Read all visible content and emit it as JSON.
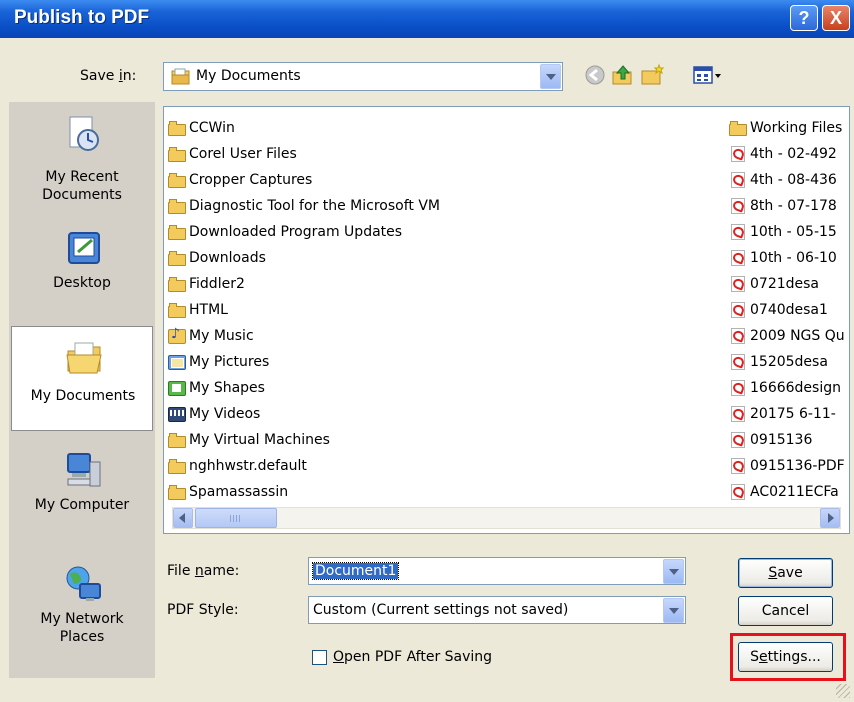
{
  "window": {
    "title": "Publish to PDF"
  },
  "titlebar": {
    "help_glyph": "?",
    "close_glyph": "X"
  },
  "save_in": {
    "label_pre": "Save ",
    "label_u": "i",
    "label_post": "n:",
    "value": "My Documents"
  },
  "toolbar_icons": [
    "back-icon",
    "up-folder-icon",
    "new-folder-icon",
    "views-menu-icon"
  ],
  "places": [
    {
      "name": "recent",
      "label": "My Recent\nDocuments",
      "icon": "recent-documents-icon"
    },
    {
      "name": "desktop",
      "label": "Desktop",
      "icon": "desktop-icon"
    },
    {
      "name": "documents",
      "label": "My Documents",
      "icon": "my-documents-icon",
      "selected": true
    },
    {
      "name": "computer",
      "label": "My Computer",
      "icon": "my-computer-icon"
    },
    {
      "name": "network",
      "label": "My Network\nPlaces",
      "icon": "network-places-icon"
    }
  ],
  "files_col1": [
    {
      "name": "CCWin",
      "type": "folder"
    },
    {
      "name": "Corel User Files",
      "type": "folder"
    },
    {
      "name": "Cropper Captures",
      "type": "folder"
    },
    {
      "name": "Diagnostic Tool for the Microsoft VM",
      "type": "folder"
    },
    {
      "name": "Downloaded Program Updates",
      "type": "folder"
    },
    {
      "name": "Downloads",
      "type": "folder"
    },
    {
      "name": "Fiddler2",
      "type": "folder"
    },
    {
      "name": "HTML",
      "type": "folder"
    },
    {
      "name": "My Music",
      "type": "music"
    },
    {
      "name": "My Pictures",
      "type": "pics"
    },
    {
      "name": "My Shapes",
      "type": "shapes"
    },
    {
      "name": "My Videos",
      "type": "videos"
    },
    {
      "name": "My Virtual Machines",
      "type": "folder"
    },
    {
      "name": "nghhwstr.default",
      "type": "folder"
    },
    {
      "name": "Spamassassin",
      "type": "folder"
    }
  ],
  "files_col2": [
    {
      "name": "Working Files",
      "type": "folder"
    },
    {
      "name": "4th - 02-492",
      "type": "pdf"
    },
    {
      "name": "4th - 08-436",
      "type": "pdf"
    },
    {
      "name": "8th - 07-178",
      "type": "pdf"
    },
    {
      "name": "10th - 05-15",
      "type": "pdf"
    },
    {
      "name": "10th - 06-10",
      "type": "pdf"
    },
    {
      "name": "0721desa",
      "type": "pdf"
    },
    {
      "name": "0740desa1",
      "type": "pdf"
    },
    {
      "name": "2009 NGS Qu",
      "type": "pdf"
    },
    {
      "name": "15205desa",
      "type": "pdf"
    },
    {
      "name": "16666design",
      "type": "pdf"
    },
    {
      "name": "20175 6-11-",
      "type": "pdf"
    },
    {
      "name": "0915136",
      "type": "pdf"
    },
    {
      "name": "0915136-PDF",
      "type": "pdf"
    },
    {
      "name": "AC0211ECFa",
      "type": "pdf"
    }
  ],
  "file_name": {
    "label_pre": "File ",
    "label_u": "n",
    "label_post": "ame:",
    "value": "Document1"
  },
  "pdf_style": {
    "label": "PDF Style:",
    "value": "Custom (Current settings not saved)"
  },
  "open_after": {
    "label_u": "O",
    "label_post": "pen PDF After Saving",
    "checked": false
  },
  "buttons": {
    "save_u": "S",
    "save_post": "ave",
    "cancel": "Cancel",
    "settings_pre": "S",
    "settings_u": "e",
    "settings_post": "ttings..."
  }
}
